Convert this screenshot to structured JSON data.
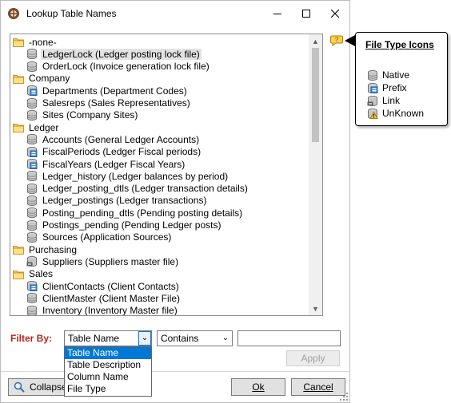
{
  "window": {
    "title": "Lookup Table Names",
    "minimize_icon": "minimize-icon",
    "maximize_icon": "maximize-icon",
    "close_icon": "close-icon"
  },
  "tree": {
    "rows": [
      {
        "kind": "folder",
        "text": "-none-"
      },
      {
        "kind": "native",
        "text": "LedgerLock  (Ledger posting lock file)",
        "selected": true
      },
      {
        "kind": "native",
        "text": "OrderLock  (Invoice generation lock file)"
      },
      {
        "kind": "folder",
        "text": "Company"
      },
      {
        "kind": "prefix",
        "text": "Departments  (Department Codes)"
      },
      {
        "kind": "native",
        "text": "Salesreps  (Sales Representatives)"
      },
      {
        "kind": "native",
        "text": "Sites  (Company Sites)"
      },
      {
        "kind": "folder",
        "text": "Ledger"
      },
      {
        "kind": "native",
        "text": "Accounts  (General Ledger Accounts)"
      },
      {
        "kind": "prefix",
        "text": "FiscalPeriods  (Ledger Fiscal periods)"
      },
      {
        "kind": "prefix",
        "text": "FiscalYears  (Ledger Fiscal Years)"
      },
      {
        "kind": "native",
        "text": "Ledger_history  (Ledger balances by period)"
      },
      {
        "kind": "native",
        "text": "Ledger_posting_dtls  (Ledger transaction details)"
      },
      {
        "kind": "native",
        "text": "Ledger_postings  (Ledger transactions)"
      },
      {
        "kind": "native",
        "text": "Posting_pending_dtls  (Pending posting details)"
      },
      {
        "kind": "native",
        "text": "Postings_pending  (Pending Ledger posts)"
      },
      {
        "kind": "native",
        "text": "Sources  (Application Sources)"
      },
      {
        "kind": "folder",
        "text": "Purchasing"
      },
      {
        "kind": "link",
        "text": "Suppliers  (Suppliers master file)"
      },
      {
        "kind": "folder",
        "text": "Sales"
      },
      {
        "kind": "prefix",
        "text": "ClientContacts  (Client Contacts)"
      },
      {
        "kind": "native",
        "text": "ClientMaster  (Client Master File)"
      },
      {
        "kind": "native",
        "text": "Inventory  (Inventory Master file)"
      }
    ]
  },
  "filter": {
    "label": "Filter By:",
    "field_value": "Table Name",
    "operator_value": "Contains",
    "text_value": "",
    "apply_label": "Apply",
    "options": [
      "Table Name",
      "Table Description",
      "Column Name",
      "File Type"
    ],
    "highlighted_option": "Table Name"
  },
  "footer": {
    "collapse_label": "Collapse",
    "ok_label": "Ok",
    "cancel_label": "Cancel"
  },
  "legend": {
    "title": "File Type Icons",
    "items": [
      {
        "kind": "native",
        "label": "Native"
      },
      {
        "kind": "prefix",
        "label": "Prefix"
      },
      {
        "kind": "link",
        "label": "Link"
      },
      {
        "kind": "unknown",
        "label": "UnKnown"
      }
    ]
  },
  "colors": {
    "filter_label": "#b3261e",
    "highlight": "#0078d7",
    "folder": "#e8b548"
  }
}
